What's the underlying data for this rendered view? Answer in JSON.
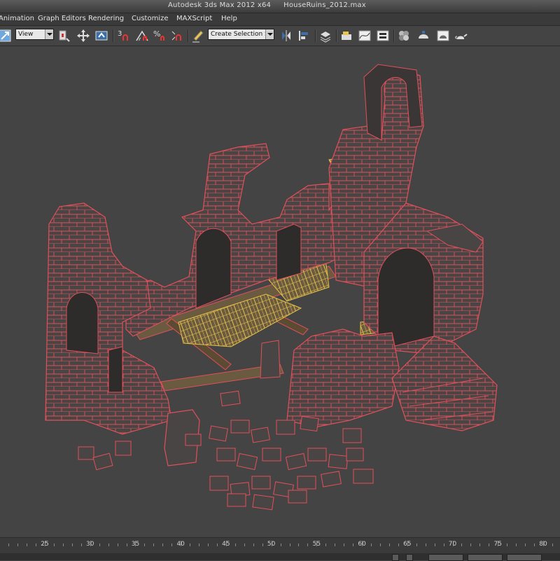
{
  "window": {
    "app_title": "Autodesk 3ds Max  2012 x64",
    "file_name": "HouseRuins_2012.max"
  },
  "menu": {
    "items": [
      {
        "label": "Animation"
      },
      {
        "label": "Graph Editors"
      },
      {
        "label": "Rendering"
      },
      {
        "label": "Customize"
      },
      {
        "label": "MAXScript"
      },
      {
        "label": "Help"
      }
    ]
  },
  "toolbar": {
    "reference_coord": "View",
    "snap_angle_label": "3",
    "snap_percent_label": "%",
    "named_selection_placeholder": "Create Selection Se"
  },
  "timeline": {
    "tick_labels": [
      "25",
      "30",
      "35",
      "40",
      "45",
      "50",
      "55",
      "60",
      "65",
      "70",
      "75",
      "80"
    ],
    "tick_values": [
      25,
      30,
      35,
      40,
      45,
      50,
      55,
      60,
      65,
      70,
      75,
      80
    ]
  },
  "colors": {
    "wire": "#e0505a",
    "stone": "#4a4545",
    "stone_dark": "#2e2b2b",
    "wood": "#6a5a40",
    "plank_wire": "#e6c14a",
    "viewport_bg": "#444444"
  }
}
